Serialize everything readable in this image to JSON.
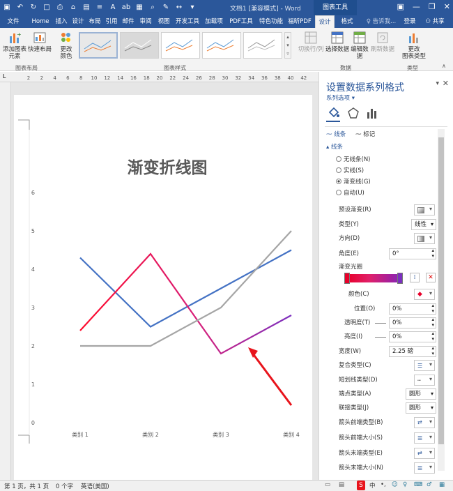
{
  "window": {
    "doc_title": "文档1 [兼容模式] - Word",
    "context_tab": "图表工具",
    "min_icon": "minimize-icon",
    "max_icon": "restore-icon",
    "close_icon": "close-icon"
  },
  "tabs": [
    {
      "label": "文件"
    },
    {
      "label": "Home"
    },
    {
      "label": "插入"
    },
    {
      "label": "设计"
    },
    {
      "label": "布局"
    },
    {
      "label": "引用"
    },
    {
      "label": "邮件"
    },
    {
      "label": "审阅"
    },
    {
      "label": "视图"
    },
    {
      "label": "开发工具"
    },
    {
      "label": "加载项"
    },
    {
      "label": "PDF工具集"
    },
    {
      "label": "特色功能"
    },
    {
      "label": "福昕PDF"
    },
    {
      "label": "设计"
    },
    {
      "label": "格式"
    }
  ],
  "tell_me": "♀ 告诉我...",
  "login": "登录",
  "share": "共享",
  "ribbon": {
    "add_element": "添加图表\n元素",
    "quick_layout": "快速布局",
    "change_colors": "更改\n颜色",
    "group_layout": "图表布局",
    "group_styles": "图表样式",
    "switch_rowcol": "切换行/列",
    "select_data": "选择数据",
    "edit_data": "编辑数\n据",
    "refresh_data": "刷新数据",
    "group_data": "数据",
    "change_type": "更改\n图表类型",
    "group_type": "类型"
  },
  "ruler_numbers": [
    "2",
    "2",
    "4",
    "6",
    "8",
    "10",
    "12",
    "14",
    "16",
    "18",
    "20",
    "22",
    "24",
    "26",
    "28",
    "30",
    "32",
    "34",
    "36",
    "38",
    "40",
    "42"
  ],
  "chart_data": {
    "type": "line",
    "title": "渐变折线图",
    "categories": [
      "类别 1",
      "类别 2",
      "类别 3",
      "类别 4"
    ],
    "ylim": [
      0,
      6
    ],
    "yticks": [
      "0",
      "1",
      "2",
      "3",
      "4",
      "5",
      "6"
    ],
    "series": [
      {
        "values": [
          4.3,
          2.5,
          3.5,
          4.5
        ],
        "color": "#4472c4"
      },
      {
        "values": [
          2.4,
          4.4,
          1.8,
          2.8
        ],
        "color": "#e8145a"
      },
      {
        "values": [
          2.0,
          2.0,
          3.0,
          5.0
        ],
        "color": "#a5a5a5"
      }
    ]
  },
  "pane": {
    "title": "设置数据系列格式",
    "subtitle": "系列选项 ▾",
    "tab_line": "线条",
    "tab_marker": "标记",
    "section": "线条",
    "radio_none": "无线条(N)",
    "radio_solid": "实线(S)",
    "radio_gradient": "渐变线(G)",
    "radio_auto": "自动(U)",
    "preset": "预设渐变(R)",
    "type": "类型(Y)",
    "type_val": "线性",
    "direction": "方向(D)",
    "angle": "角度(E)",
    "angle_val": "0°",
    "stops": "渐变光圈",
    "color": "颜色(C)",
    "position": "位置(O)",
    "position_val": "0%",
    "transparency": "透明度(T)",
    "transparency_val": "0%",
    "brightness": "亮度(I)",
    "brightness_val": "0%",
    "width": "宽度(W)",
    "width_val": "2.25 磅",
    "compound": "复合类型(C)",
    "dash": "短划线类型(D)",
    "cap": "端点类型(A)",
    "cap_val": "圆形",
    "join": "联接类型(J)",
    "join_val": "圆形",
    "arrow_begin_type": "箭头前端类型(B)",
    "arrow_begin_size": "箭头前端大小(S)",
    "arrow_end_type": "箭头末端类型(E)",
    "arrow_end_size": "箭头末端大小(N)"
  },
  "status": {
    "page": "第 1 页，共 1 页",
    "words": "0 个字",
    "lang": "英语(美国)"
  }
}
